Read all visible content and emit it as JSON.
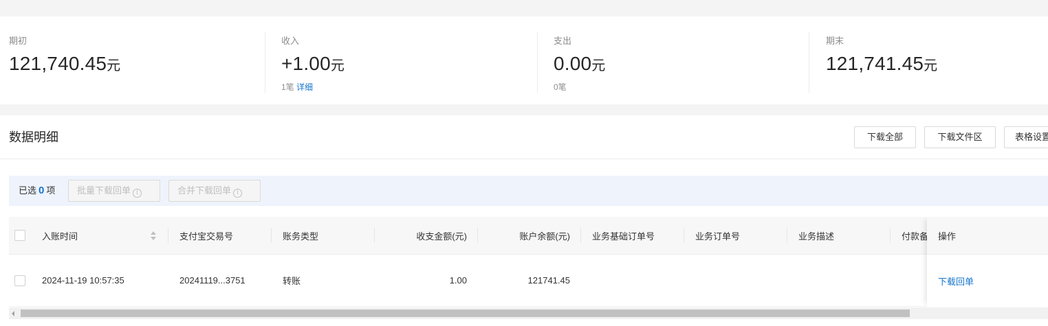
{
  "summary": [
    {
      "label": "期初",
      "amount": "121,740.45",
      "unit": "元"
    },
    {
      "label": "收入",
      "amount": "+1.00",
      "unit": "元",
      "count": "1笔",
      "link": "详细"
    },
    {
      "label": "支出",
      "amount": "0.00",
      "unit": "元",
      "count": "0笔"
    },
    {
      "label": "期末",
      "amount": "121,741.45",
      "unit": "元"
    }
  ],
  "detail": {
    "title": "数据明细",
    "buttons": {
      "download_all": "下载全部",
      "download_area": "下载文件区",
      "table_settings": "表格设置"
    }
  },
  "selection": {
    "prefix": "已选",
    "count": "0",
    "suffix": "项",
    "batch_download": "批量下载回单",
    "merge_download": "合并下载回单"
  },
  "table": {
    "columns": [
      "入账时间",
      "支付宝交易号",
      "账务类型",
      "收支金额(元)",
      "账户余额(元)",
      "业务基础订单号",
      "业务订单号",
      "业务描述",
      "付款备注",
      "操作"
    ],
    "rows": [
      {
        "time": "2024-11-19 10:57:35",
        "trade_no": "20241119...3751",
        "type": "转账",
        "amount": "1.00",
        "balance": "121741.45",
        "base_order": "",
        "order": "",
        "desc": "",
        "remark": "",
        "action": "下载回单"
      }
    ]
  },
  "colors": {
    "link": "#1677cc",
    "selection_bg": "#eef3fc"
  }
}
